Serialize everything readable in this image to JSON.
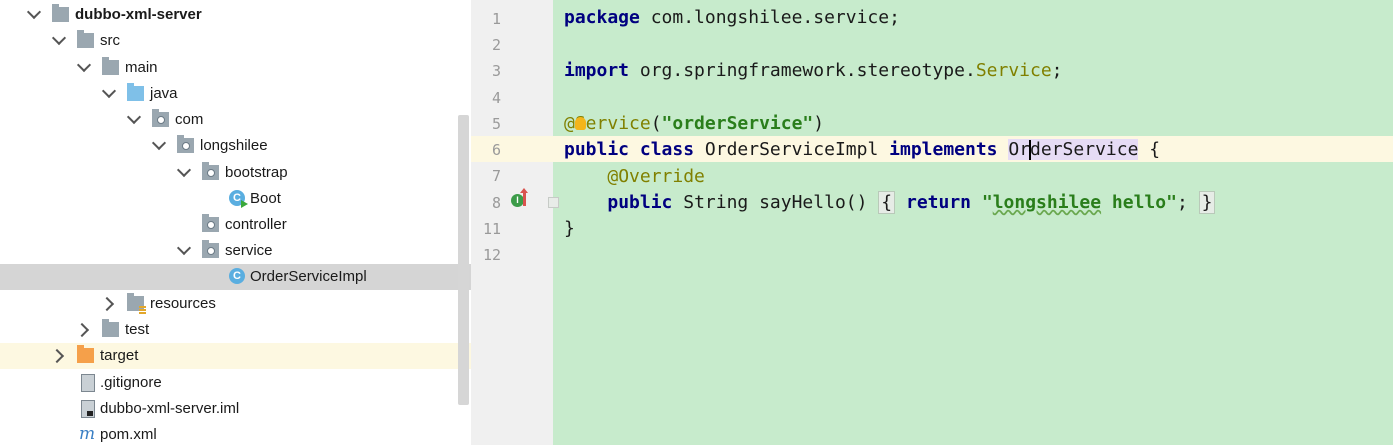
{
  "tree": {
    "items": [
      {
        "label": "dubbo-xml-server",
        "icon": "module-folder-icon"
      },
      {
        "label": "src",
        "icon": "folder-icon"
      },
      {
        "label": "main",
        "icon": "folder-icon"
      },
      {
        "label": "java",
        "icon": "source-folder-icon"
      },
      {
        "label": "com",
        "icon": "package-icon"
      },
      {
        "label": "longshilee",
        "icon": "package-icon"
      },
      {
        "label": "bootstrap",
        "icon": "package-icon"
      },
      {
        "label": "Boot",
        "icon": "runnable-class-icon"
      },
      {
        "label": "controller",
        "icon": "package-icon"
      },
      {
        "label": "service",
        "icon": "package-icon"
      },
      {
        "label": "OrderServiceImpl",
        "icon": "class-icon"
      },
      {
        "label": "resources",
        "icon": "resources-folder-icon"
      },
      {
        "label": "test",
        "icon": "folder-icon"
      },
      {
        "label": "target",
        "icon": "excluded-folder-icon"
      },
      {
        "label": ".gitignore",
        "icon": "file-icon"
      },
      {
        "label": "dubbo-xml-server.iml",
        "icon": "iml-file-icon"
      },
      {
        "label": "pom.xml",
        "icon": "maven-icon"
      }
    ]
  },
  "editor": {
    "line_numbers": [
      "1",
      "2",
      "3",
      "4",
      "5",
      "6",
      "7",
      "8",
      "11",
      "12"
    ],
    "code": {
      "l1_kw": "package",
      "l1_rest": " com.longshilee.service;",
      "l3_kw": "import",
      "l3_rest": " org.springframework.stereotype.",
      "l3_type": "Service",
      "l3_end": ";",
      "l5_at": "@",
      "l5_ann": "Service",
      "l5_paren_open": "(",
      "l5_str": "\"orderService\"",
      "l5_paren_close": ")",
      "l6_kw1": "public",
      "l6_kw2": "class",
      "l6_name": " OrderServiceImpl ",
      "l6_kw3": "implements",
      "l6_ref_a": "Or",
      "l6_ref_b": "derService",
      "l6_brace": " {",
      "l7_ann": "@Override",
      "l8_kw1": "public",
      "l8_sig": " String sayHello() ",
      "l8_fold_open": "{",
      "l8_kw2": "return",
      "l8_str_a": "\"",
      "l8_str_b": "longshilee",
      "l8_str_c": " hello\"",
      "l8_semi": ";",
      "l8_fold_close": "}",
      "l11": "}"
    }
  }
}
